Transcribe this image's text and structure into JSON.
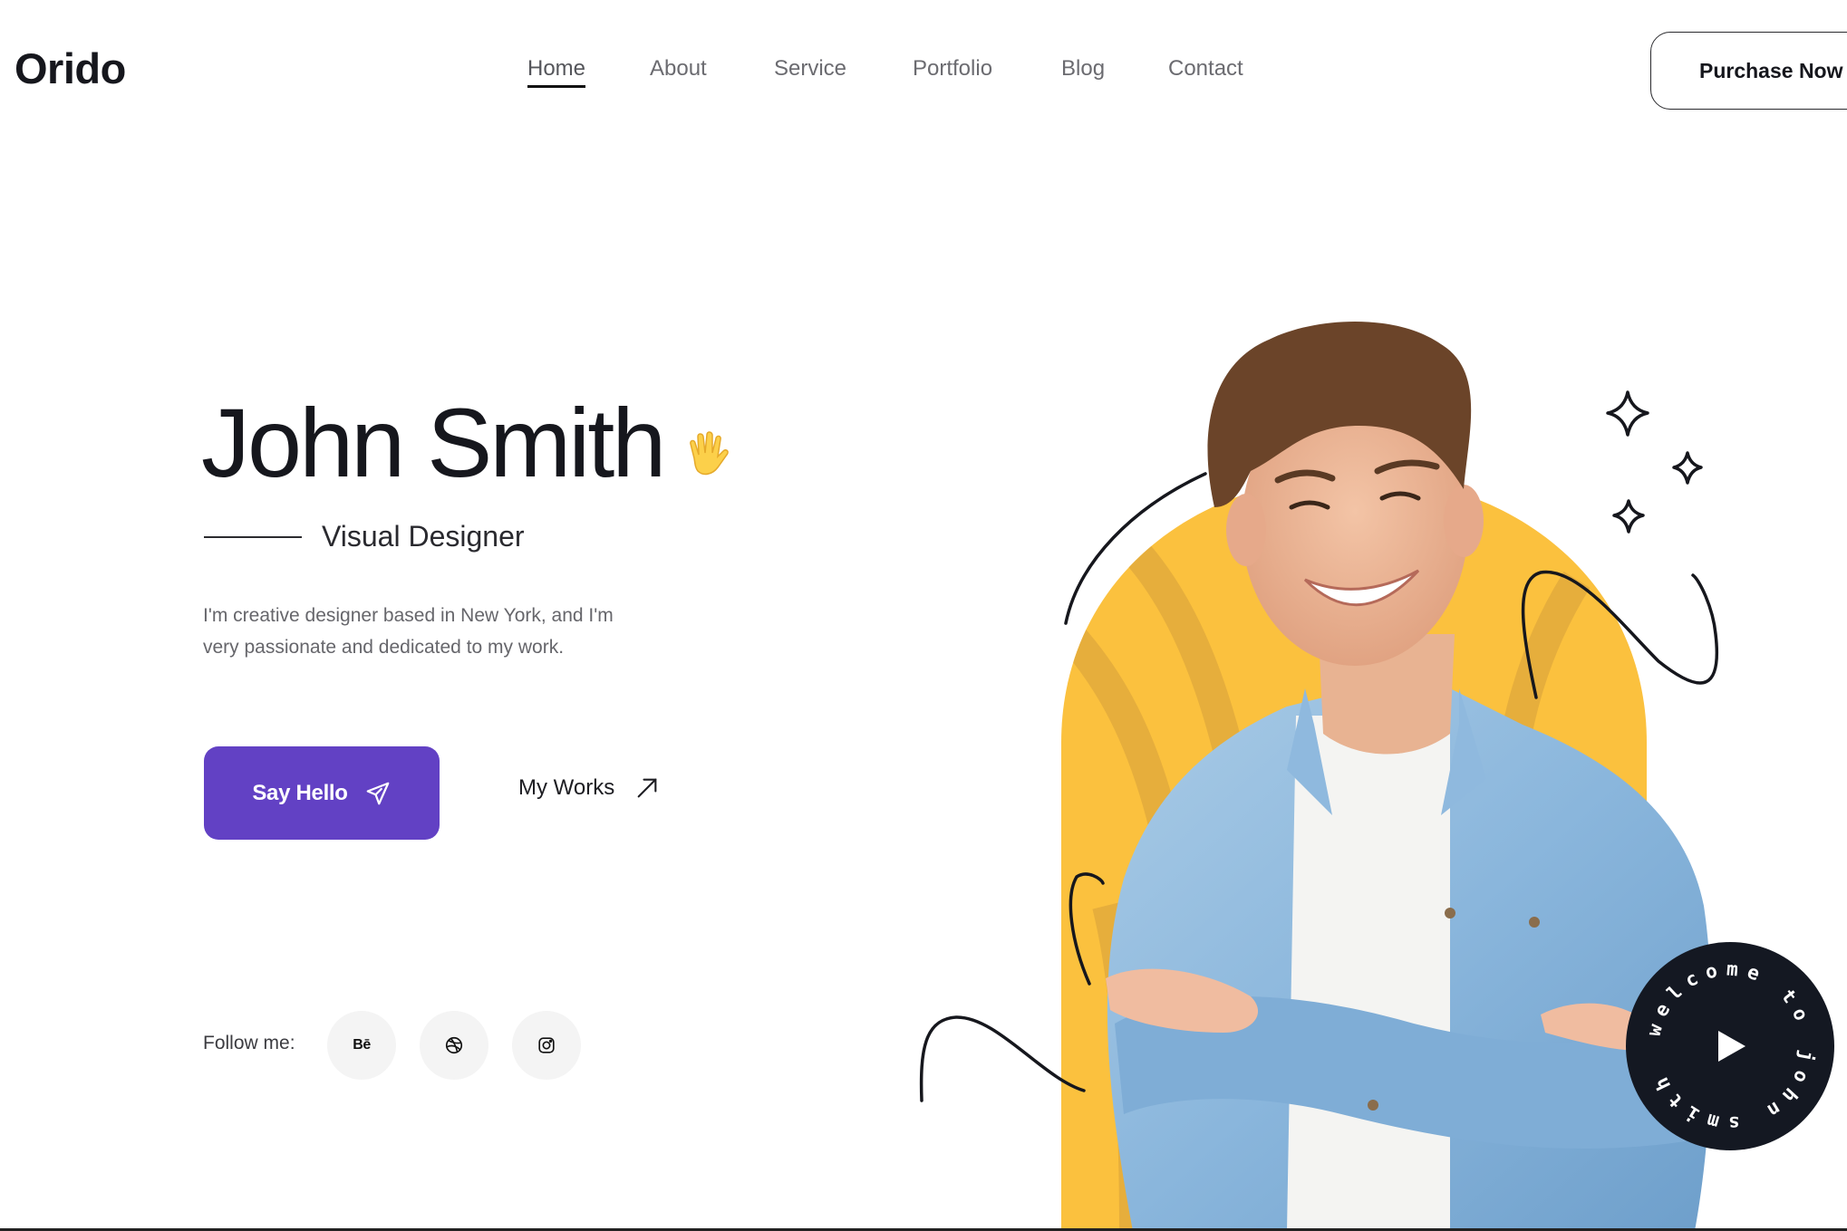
{
  "brand": {
    "logo": "Orido"
  },
  "nav": {
    "items": [
      {
        "label": "Home",
        "active": true
      },
      {
        "label": "About",
        "active": false
      },
      {
        "label": "Service",
        "active": false
      },
      {
        "label": "Portfolio",
        "active": false
      },
      {
        "label": "Blog",
        "active": false
      },
      {
        "label": "Contact",
        "active": false
      }
    ],
    "cta_label": "Purchase Now"
  },
  "hero": {
    "name": "John Smith",
    "name_emoji": "waving-hand-icon",
    "role": "Visual Designer",
    "description_lines": [
      "I'm creative designer based in New York, and I'm",
      "very passionate and dedicated to my work."
    ],
    "primary_button": {
      "label": "Say Hello",
      "icon": "paper-plane-icon"
    },
    "secondary_button": {
      "label": "My Works",
      "icon": "arrow-up-right-icon"
    },
    "follow_label": "Follow me:",
    "socials": [
      {
        "name": "behance",
        "glyph": "Bē"
      },
      {
        "name": "dribbble",
        "glyph": "dribbble-icon"
      },
      {
        "name": "instagram",
        "glyph": "instagram-icon"
      }
    ]
  },
  "badge": {
    "circular_text": "welcome to john smith",
    "icon": "play-icon"
  },
  "colors": {
    "primary": "#6241c4",
    "accent_yellow": "#fbc13e",
    "stripe_yellow": "#e6ae3c",
    "text_dark": "#16171d",
    "badge_bg": "#141822"
  }
}
